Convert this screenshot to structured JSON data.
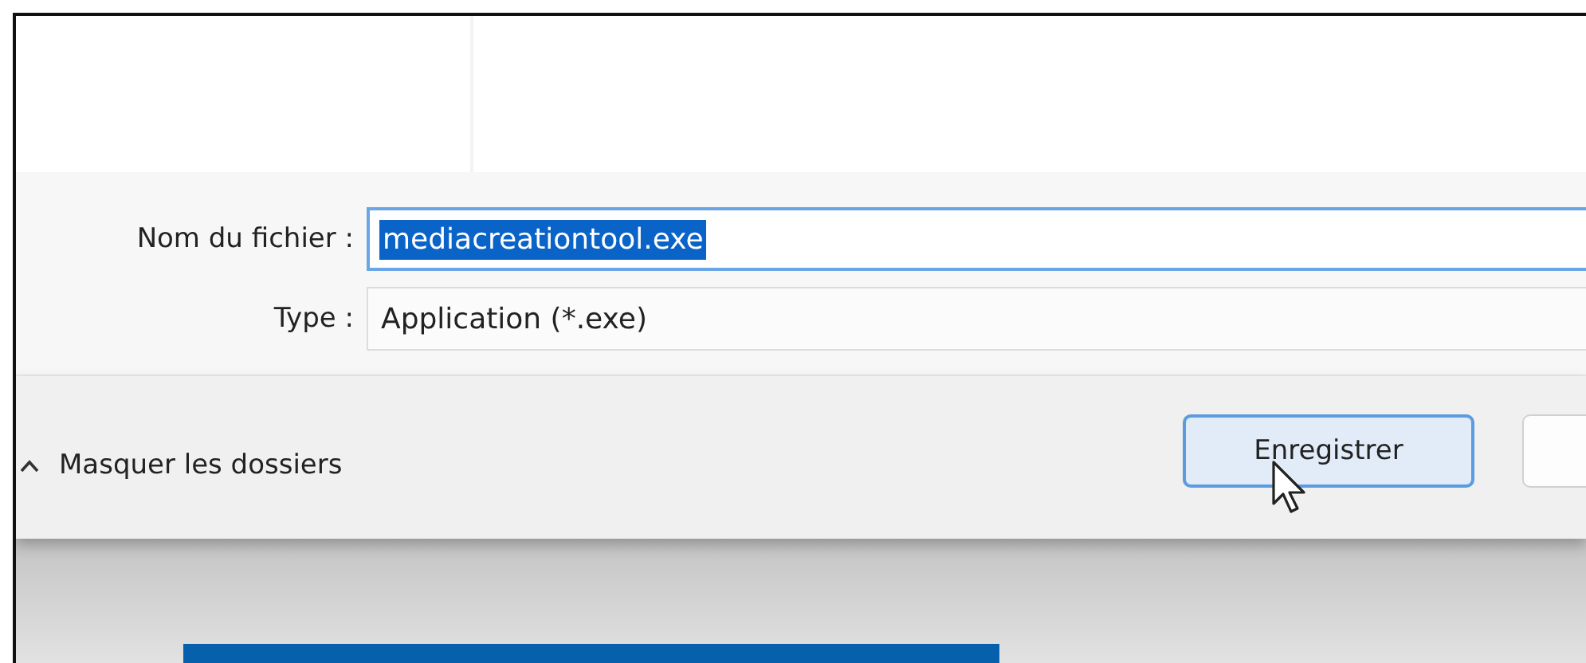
{
  "form": {
    "fields": [
      {
        "kind": "input",
        "label": "Nom du fichier :",
        "value": "mediacreationtool.exe",
        "text_selected": true
      },
      {
        "kind": "select",
        "label": "Type :",
        "value": "Application (*.exe)",
        "text_selected": false
      }
    ]
  },
  "footer": {
    "toggle": {
      "label": "Masquer les dossiers"
    },
    "buttons": [
      {
        "label": "Enregistrer",
        "focused": true
      },
      {
        "focused": false
      }
    ]
  }
}
